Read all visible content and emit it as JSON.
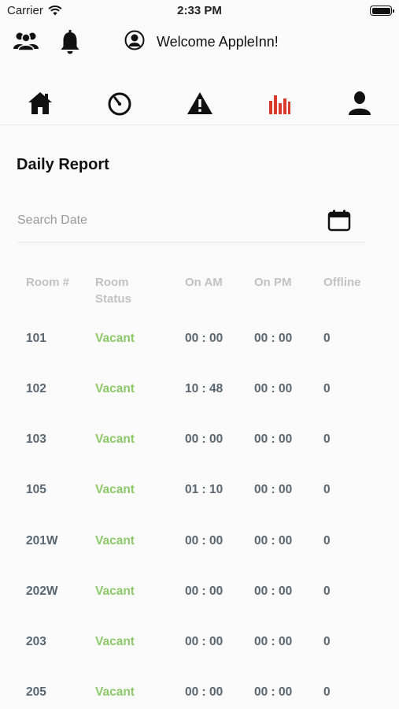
{
  "status_bar": {
    "carrier": "Carrier",
    "time": "2:33 PM"
  },
  "header": {
    "welcome": "Welcome AppleInn!"
  },
  "tabs": [
    {
      "icon": "home-icon"
    },
    {
      "icon": "timer-icon"
    },
    {
      "icon": "warning-icon"
    },
    {
      "icon": "bar-chart-icon",
      "active": true
    },
    {
      "icon": "user-icon"
    }
  ],
  "colors": {
    "active_tab": "#d93a2b",
    "vacant": "#8dc96a",
    "cell_text": "#5a6670",
    "header_text": "#c2c2c2"
  },
  "page": {
    "title": "Daily Report"
  },
  "search": {
    "placeholder": "Search Date"
  },
  "table": {
    "headers": {
      "room": "Room #",
      "status_line1": "Room",
      "status_line2": "Status",
      "on_am": "On AM",
      "on_pm": "On PM",
      "offline": "Offline"
    },
    "rows": [
      {
        "room": "101",
        "status": "Vacant",
        "on_am": "00 : 00",
        "on_pm": "00 : 00",
        "offline": "0"
      },
      {
        "room": "102",
        "status": "Vacant",
        "on_am": "10 : 48",
        "on_pm": "00 : 00",
        "offline": "0"
      },
      {
        "room": "103",
        "status": "Vacant",
        "on_am": "00 : 00",
        "on_pm": "00 : 00",
        "offline": "0"
      },
      {
        "room": "105",
        "status": "Vacant",
        "on_am": "01 : 10",
        "on_pm": "00 : 00",
        "offline": "0"
      },
      {
        "room": "201W",
        "status": "Vacant",
        "on_am": "00 : 00",
        "on_pm": "00 : 00",
        "offline": "0"
      },
      {
        "room": "202W",
        "status": "Vacant",
        "on_am": "00 : 00",
        "on_pm": "00 : 00",
        "offline": "0"
      },
      {
        "room": "203",
        "status": "Vacant",
        "on_am": "00 : 00",
        "on_pm": "00 : 00",
        "offline": "0"
      },
      {
        "room": "205",
        "status": "Vacant",
        "on_am": "00 : 00",
        "on_pm": "00 : 00",
        "offline": "0"
      }
    ]
  }
}
